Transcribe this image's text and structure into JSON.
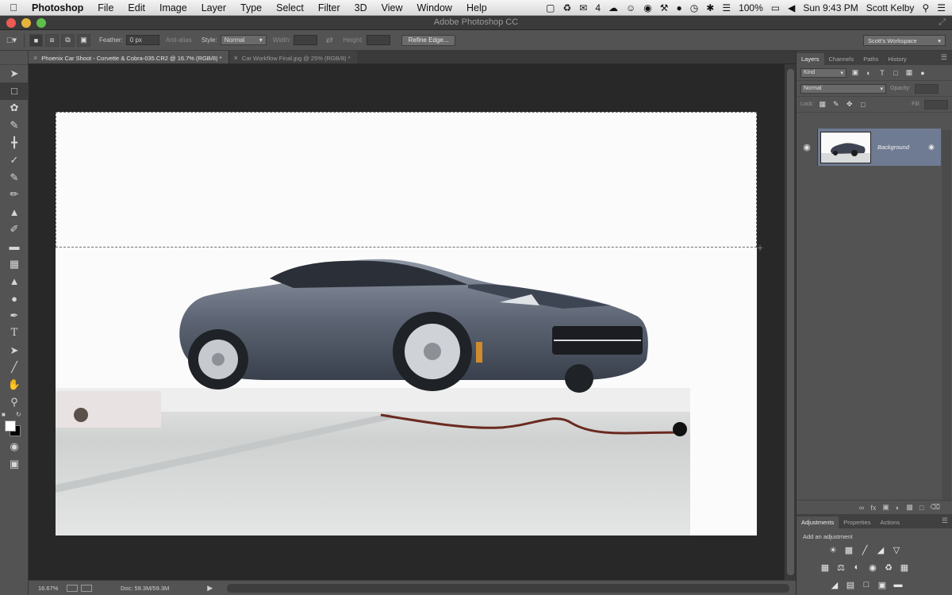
{
  "menubar": {
    "app_name": "Photoshop",
    "menus": [
      "File",
      "Edit",
      "Image",
      "Layer",
      "Type",
      "Select",
      "Filter",
      "3D",
      "View",
      "Window",
      "Help"
    ],
    "battery": "100%",
    "clock": "Sun 9:43 PM",
    "user": "Scott Kelby",
    "status_count": "4"
  },
  "window": {
    "title": "Adobe Photoshop CC"
  },
  "options": {
    "feather_label": "Feather:",
    "feather_value": "0 px",
    "anti_alias_label": "Anti-alias",
    "style_label": "Style:",
    "style_value": "Normal",
    "width_label": "Width:",
    "height_label": "Height:",
    "refine_edge": "Refine Edge...",
    "workspace": "Scott's Workspace"
  },
  "tabs": [
    {
      "label": "Phoenix Car Shoot - Corvette & Cobra-035.CR2 @ 16.7% (RGB/8) *",
      "active": true
    },
    {
      "label": "Car Workflow Final.jpg @ 25% (RGB/8) *",
      "active": false
    }
  ],
  "status": {
    "zoom": "16.67%",
    "doc": "Doc: 59.3M/59.3M"
  },
  "layers_panel": {
    "tabs": [
      "Layers",
      "Channels",
      "Paths",
      "History"
    ],
    "filter_kind": "Kind",
    "blend_mode": "Normal",
    "opacity_label": "Opacity:",
    "lock_label": "Lock:",
    "fill_label": "Fill:",
    "layer_name": "Background"
  },
  "adjustments_panel": {
    "tabs": [
      "Adjustments",
      "Properties",
      "Actions"
    ],
    "title": "Add an adjustment"
  },
  "colors": {
    "accent_layer": "#6f7b92",
    "chrome": "#535353",
    "canvas_bg": "#282828"
  }
}
